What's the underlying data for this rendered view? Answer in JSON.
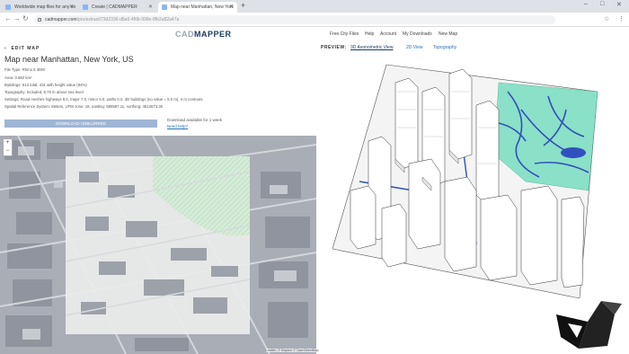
{
  "browser": {
    "tabs": [
      {
        "label": "Worldwide map files for any do"
      },
      {
        "label": "Create | CADMAPPER"
      },
      {
        "label": "Map near Manhattan, New York"
      }
    ],
    "new_tab": "+",
    "window_controls": [
      "–",
      "□",
      "✕"
    ],
    "url_host": "cadmapper.com",
    "url_path": "/pro/extract/73d2336-d8a6-4f0b-998e-8fb2a82a47a",
    "icons": [
      "back-icon",
      "forward-icon",
      "reload-icon",
      "lock-icon",
      "star-icon",
      "menu-icon"
    ]
  },
  "header": {
    "logo_prefix": "CAD",
    "logo_suffix": "MAPPER",
    "nav": [
      "Free City Files",
      "Help",
      "Account",
      "My Downloads",
      "New Map"
    ]
  },
  "left": {
    "edit_label": "EDIT MAP",
    "title": "Map near Manhattan, New York, US",
    "meta": [
      "File Type: Rhino 5 3DM",
      "Area: 0.982 km²",
      "Buildings: 513 total, 431 with height value (84%)",
      "Topography: Included, 8.75 m above sea level",
      "Settings: Road meshes highways 8.0, major 7.0, minor 6.0, paths 0.0, 3D buildings (no value = 5.0 m), 4 m contours",
      "Spatial Reference System: Meters, UTM zone: 18, easting: 585587.11, northing: 4512673.30"
    ],
    "download_label": "DOWNLOAD UNBLURRED",
    "available": "Download available for 1 week",
    "need_help": "Need help?",
    "zoom_in": "+",
    "zoom_out": "−",
    "attribution": "Leaflet | © Mapbox © OpenStreetMap"
  },
  "right": {
    "preview_label": "PREVIEW:",
    "tabs": [
      "3D Axonometric View",
      "2D View",
      "Topography"
    ],
    "selected_tab": "3D Axonometric View"
  },
  "colors": {
    "park": "#7fd9c3",
    "water": "#2f4fb8",
    "accent": "#2a6fbd",
    "button": "#9fb6d6"
  }
}
